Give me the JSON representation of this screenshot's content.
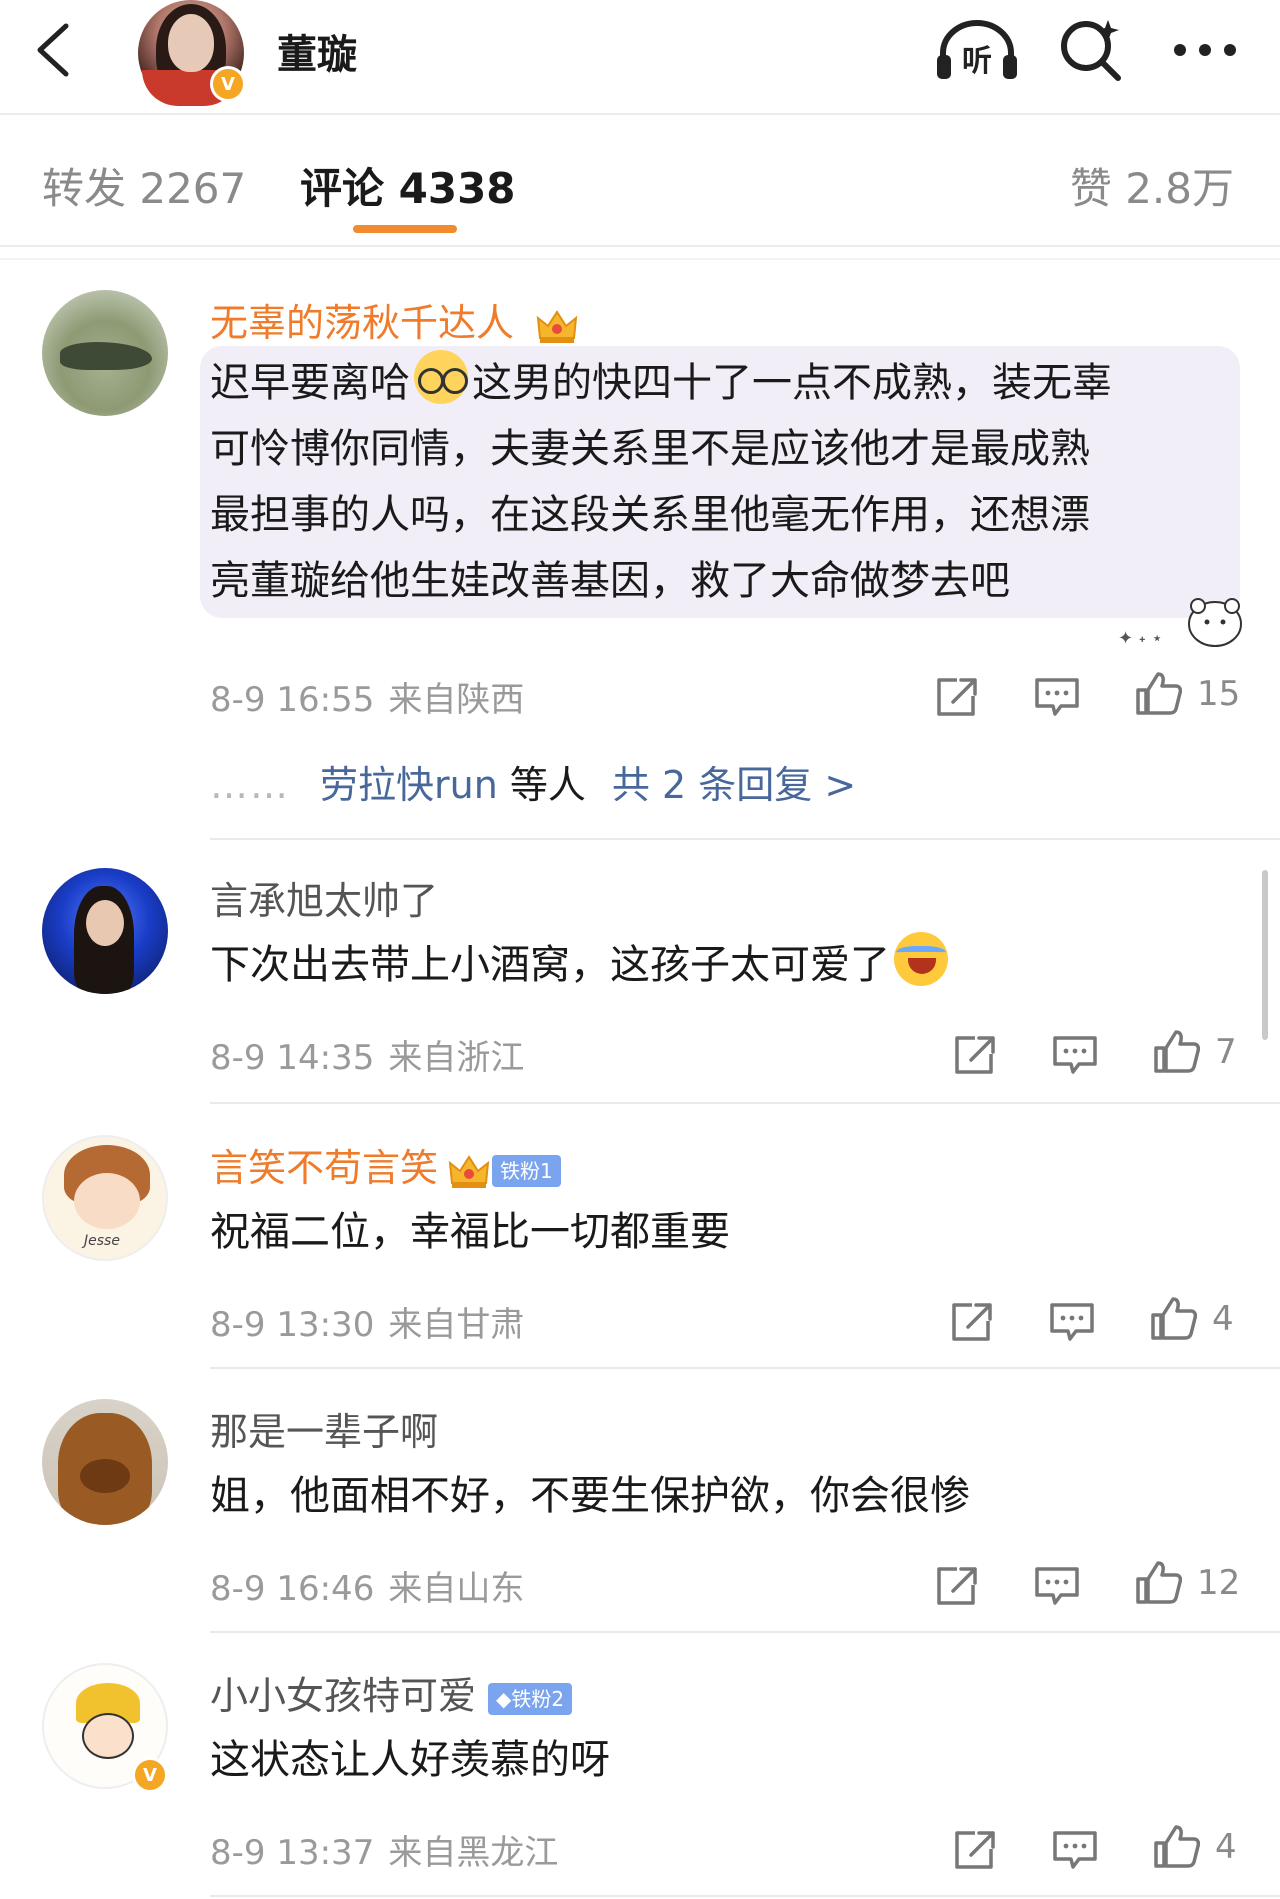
{
  "header": {
    "user_name": "董璇",
    "verified_badge": "V",
    "icons": {
      "back": "back-arrow-icon",
      "listen": "听",
      "search": "search-icon",
      "more": "more-dots-icon"
    }
  },
  "tabs": {
    "repost": "转发 2267",
    "comment": "评论 4338",
    "like": "赞 2.8万",
    "active": "comment",
    "accent_color": "#f28a2e"
  },
  "comments": [
    {
      "user": "无辜的荡秋千达人",
      "name_color": "#ef7b2b",
      "has_crown": true,
      "text_before_emoji": "迟早要离哈",
      "text_lines": [
        "这男的快四十了一点不成熟，装无辜",
        "可怜博你同情，夫妻关系里不是应该他才是最成熟",
        "最担事的人吗，在这段关系里他毫无作用，还想漂",
        "亮董璇给他生娃改善基因，救了大命做梦去吧"
      ],
      "time": "8-9 16:55",
      "location": "来自陕西",
      "likes": "15",
      "replies": {
        "dots": "……",
        "names": "劳拉快run",
        "rest": "等人",
        "total": "共 2 条回复 >"
      }
    },
    {
      "user": "言承旭太帅了",
      "text": "下次出去带上小酒窝，这孩子太可爱了",
      "time": "8-9 14:35",
      "location": "来自浙江",
      "likes": "7"
    },
    {
      "user": "言笑不苟言笑",
      "name_color": "#ef7b2b",
      "has_crown": true,
      "fan_badge": "铁粉1",
      "avatar_caption": "Jesse",
      "text": "祝福二位，幸福比一切都重要",
      "time": "8-9 13:30",
      "location": "来自甘肃",
      "likes": "4"
    },
    {
      "user": "那是一辈子啊",
      "text": "姐，他面相不好，不要生保护欲，你会很惨",
      "time": "8-9 16:46",
      "location": "来自山东",
      "likes": "12"
    },
    {
      "user": "小小女孩特可爱",
      "fan_badge": "铁粉2",
      "verified_badge": "V",
      "text": "这状态让人好羡慕的呀",
      "time": "8-9 13:37",
      "location": "来自黑龙江",
      "likes": "4"
    }
  ]
}
